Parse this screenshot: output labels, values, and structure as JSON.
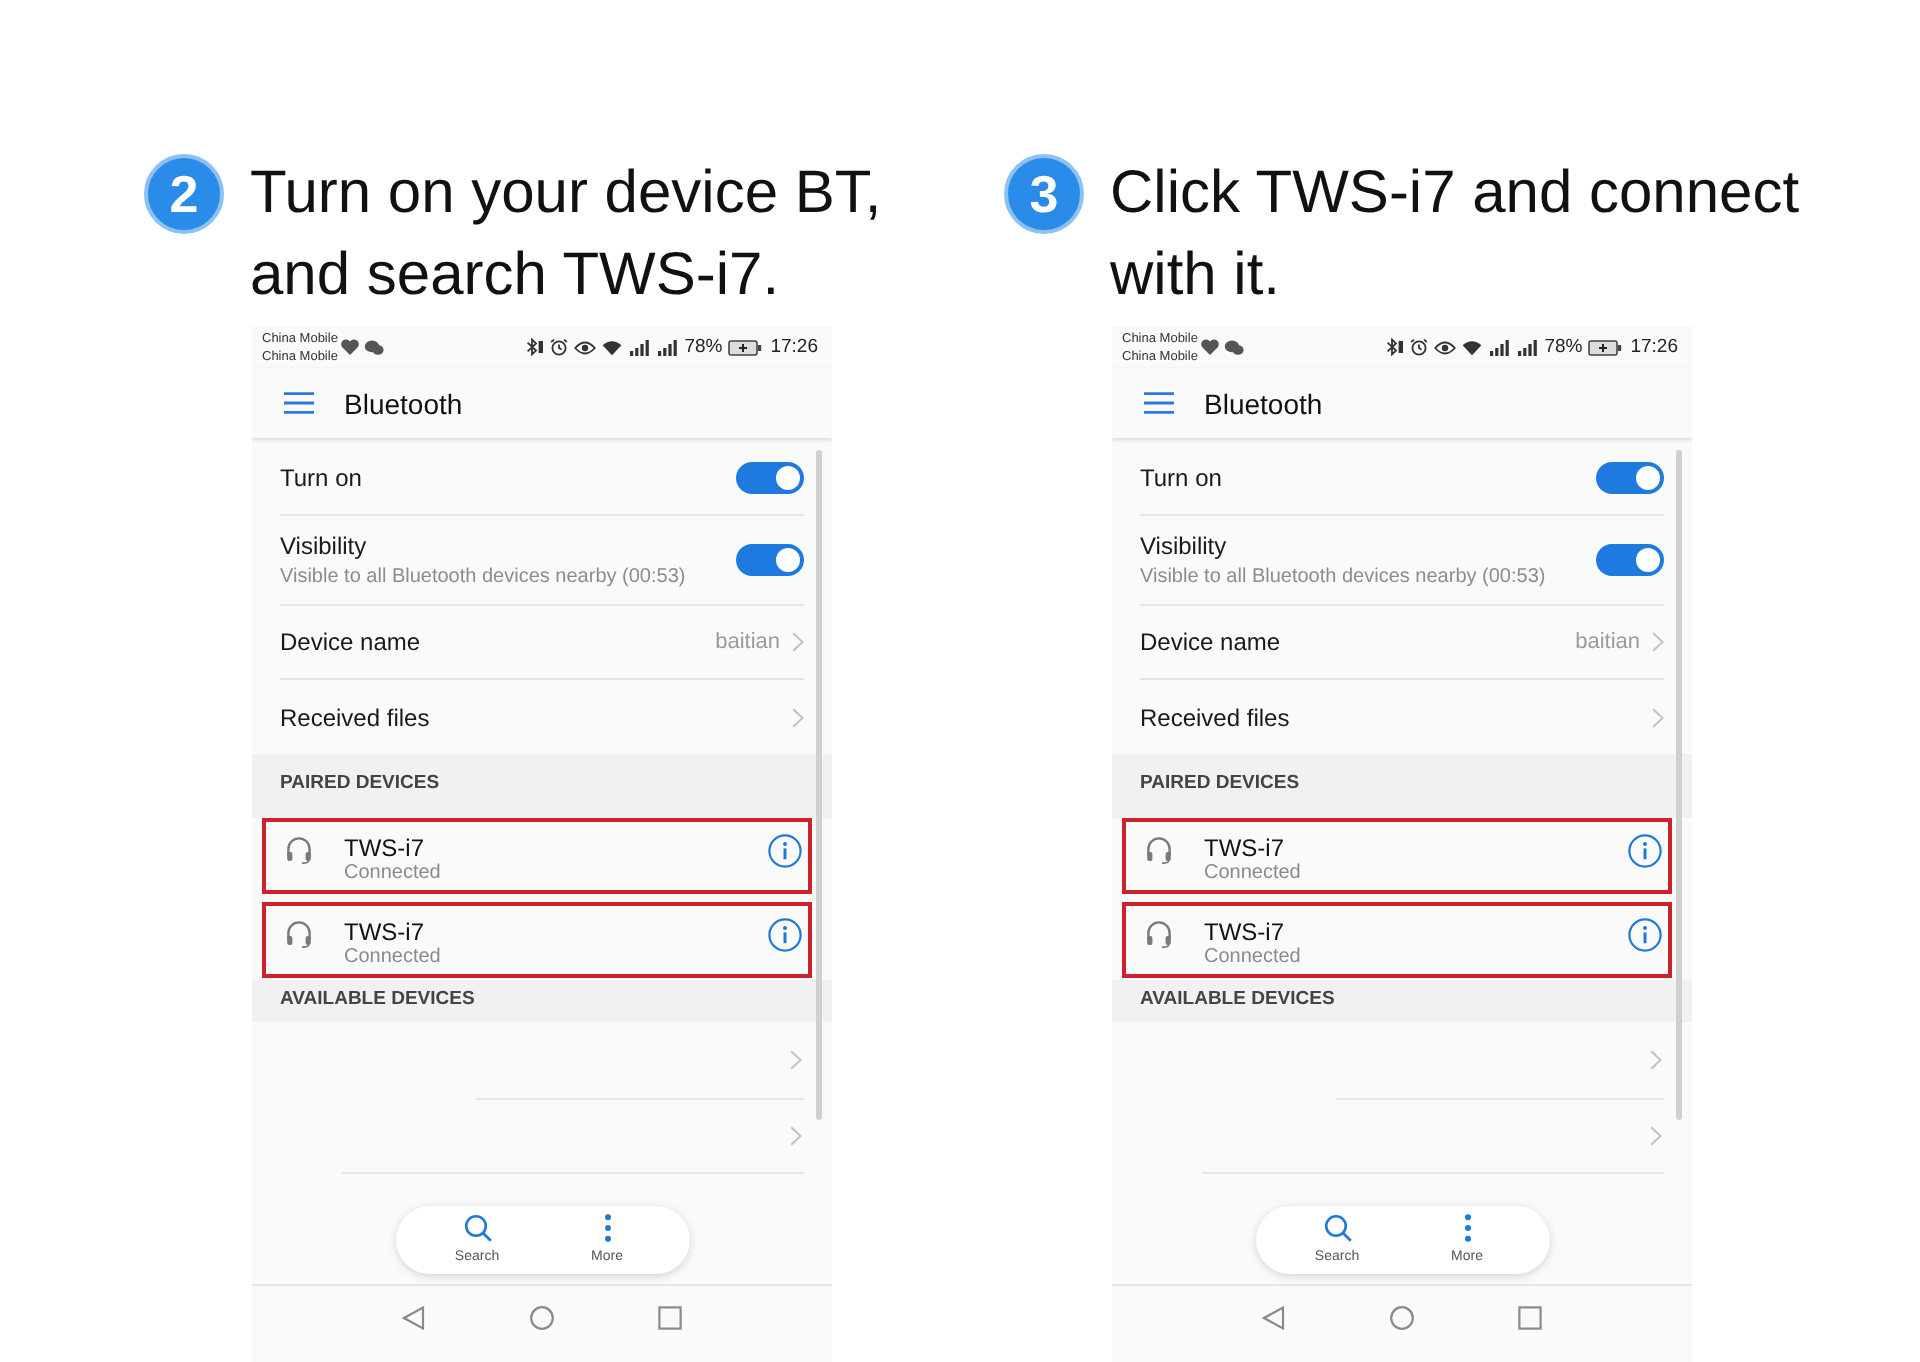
{
  "steps": [
    {
      "number": "2",
      "title_lines": [
        "Turn on your device BT,",
        "and search TWS-i7."
      ],
      "phone": {
        "status_bar": {
          "carriers": [
            "China Mobile",
            "China Mobile"
          ],
          "battery": "78%",
          "time": "17:26"
        },
        "app_bar": {
          "title": "Bluetooth"
        },
        "settings": [
          {
            "kind": "toggle",
            "label": "Turn on",
            "on": true
          },
          {
            "kind": "toggle",
            "label": "Visibility",
            "subtitle": "Visible to all Bluetooth devices nearby (00:53)",
            "on": true
          },
          {
            "kind": "link",
            "label": "Device name",
            "value": "baitian"
          },
          {
            "kind": "link",
            "label": "Received files"
          }
        ],
        "paired_devices": {
          "header": "PAIRED DEVICES",
          "devices": [
            {
              "name": "TWS-i7",
              "status": "Connected",
              "highlighted": true
            },
            {
              "name": "TWS-i7",
              "status": "Connected",
              "highlighted": true
            }
          ]
        },
        "available_devices": {
          "header": "AVAILABLE DEVICES"
        },
        "bottom_actions": [
          {
            "kind": "search",
            "label": "Search"
          },
          {
            "kind": "more",
            "label": "More"
          }
        ]
      }
    },
    {
      "number": "3",
      "title_lines": [
        "Click TWS-i7 and connect",
        "with it."
      ],
      "phone": {
        "status_bar": {
          "carriers": [
            "China Mobile",
            "China Mobile"
          ],
          "battery": "78%",
          "time": "17:26"
        },
        "app_bar": {
          "title": "Bluetooth"
        },
        "settings": [
          {
            "kind": "toggle",
            "label": "Turn on",
            "on": true
          },
          {
            "kind": "toggle",
            "label": "Visibility",
            "subtitle": "Visible to all Bluetooth devices nearby (00:53)",
            "on": true
          },
          {
            "kind": "link",
            "label": "Device name",
            "value": "baitian"
          },
          {
            "kind": "link",
            "label": "Received files"
          }
        ],
        "paired_devices": {
          "header": "PAIRED DEVICES",
          "devices": [
            {
              "name": "TWS-i7",
              "status": "Connected",
              "highlighted": true
            },
            {
              "name": "TWS-i7",
              "status": "Connected",
              "highlighted": true
            }
          ]
        },
        "available_devices": {
          "header": "AVAILABLE DEVICES"
        },
        "bottom_actions": [
          {
            "kind": "search",
            "label": "Search"
          },
          {
            "kind": "more",
            "label": "More"
          }
        ]
      }
    }
  ]
}
